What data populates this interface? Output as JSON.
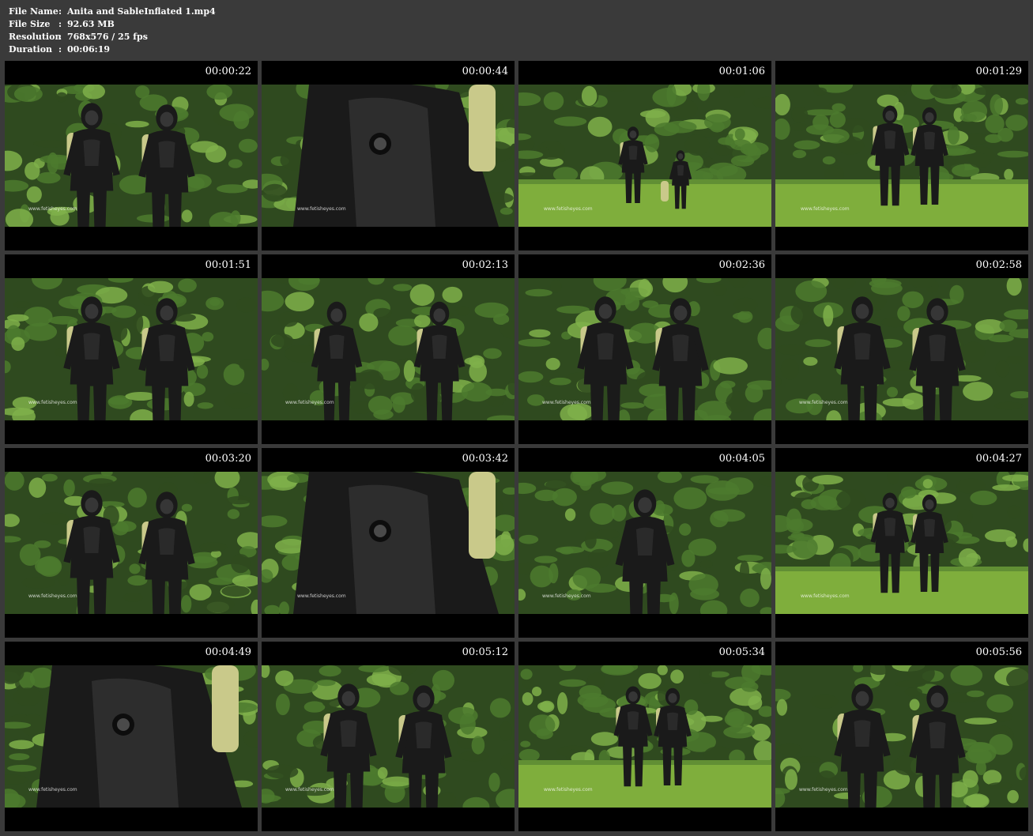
{
  "file_info": [
    {
      "label": "File Name",
      "sep": ":",
      "value": "Anita and SableInflated 1.mp4"
    },
    {
      "label": "File Size",
      "sep": ":",
      "value": "92.63 MB"
    },
    {
      "label": "Resolution",
      "sep": ":",
      "value": "768x576 / 25 fps"
    },
    {
      "label": "Duration",
      "sep": ":",
      "value": "00:06:19"
    }
  ],
  "watermark_text": "www.fetisheyes.com",
  "thumbnails": [
    {
      "time": "00:00:22",
      "scene": "hedge-two-close"
    },
    {
      "time": "00:00:44",
      "scene": "suit-closeup"
    },
    {
      "time": "00:01:06",
      "scene": "lawn-crouch"
    },
    {
      "time": "00:01:29",
      "scene": "lawn-two-standing"
    },
    {
      "time": "00:01:51",
      "scene": "hedge-two-close"
    },
    {
      "time": "00:02:13",
      "scene": "hedge-two-apart"
    },
    {
      "time": "00:02:36",
      "scene": "hedge-two-close"
    },
    {
      "time": "00:02:58",
      "scene": "hedge-two-close"
    },
    {
      "time": "00:03:20",
      "scene": "hedge-two-close"
    },
    {
      "time": "00:03:42",
      "scene": "suit-closeup"
    },
    {
      "time": "00:04:05",
      "scene": "hedge-one-center"
    },
    {
      "time": "00:04:27",
      "scene": "lawn-two-standing"
    },
    {
      "time": "00:04:49",
      "scene": "suit-closeup"
    },
    {
      "time": "00:05:12",
      "scene": "hedge-two-close"
    },
    {
      "time": "00:05:34",
      "scene": "lawn-two-standing"
    },
    {
      "time": "00:05:56",
      "scene": "hedge-two-close"
    }
  ],
  "colors": {
    "background": "#3a3a3a",
    "tile": "#000000",
    "foliage_dark": "#2f4a1f",
    "foliage_mid": "#4c7a2e",
    "foliage_light": "#7fb04a",
    "lawn": "#7fae3c",
    "suit": "#1a1a1a",
    "suit_highlight": "#4a4a4a",
    "tank": "#c9c98a"
  }
}
